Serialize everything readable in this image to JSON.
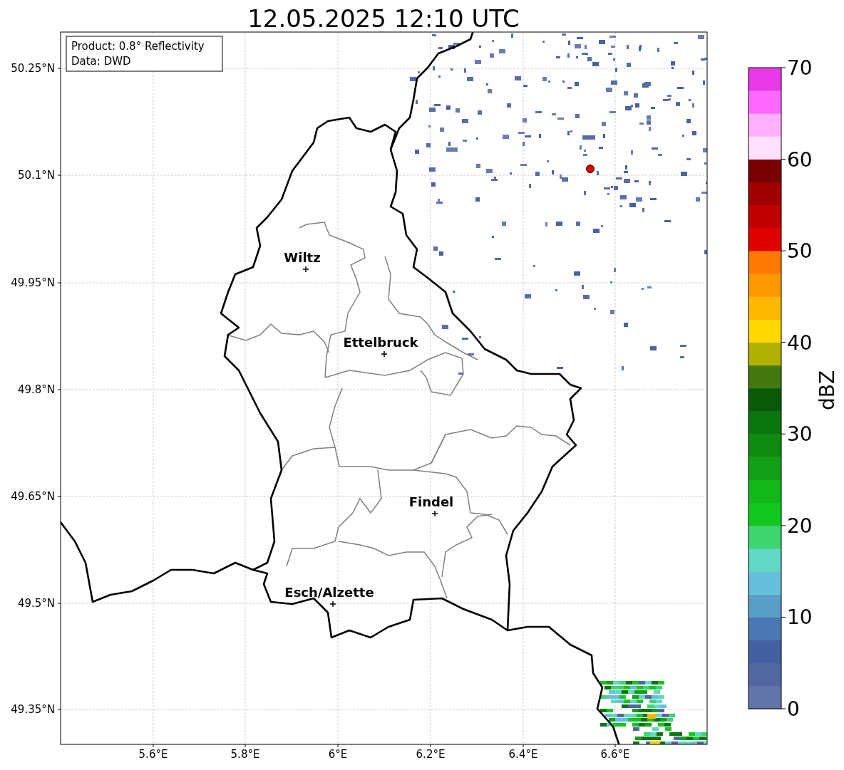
{
  "title": "12.05.2025 12:10 UTC",
  "info_box": [
    "Product: 0.8° Reflectivity",
    "Data: DWD"
  ],
  "lat_ticks": [
    "50.25°N",
    "50.1°N",
    "49.95°N",
    "49.8°N",
    "49.65°N",
    "49.5°N",
    "49.35°N"
  ],
  "lon_ticks": [
    "5.6°E",
    "5.8°E",
    "6°E",
    "6.2°E",
    "6.4°E",
    "6.6°E"
  ],
  "cities": [
    {
      "name": "Wiltz"
    },
    {
      "name": "Ettelbruck"
    },
    {
      "name": "Findel"
    },
    {
      "name": "Esch/Alzette"
    }
  ],
  "colorbar": {
    "label": "dBZ",
    "ticks": [
      "70",
      "60",
      "50",
      "40",
      "30",
      "20",
      "10",
      "0"
    ],
    "bands": [
      {
        "color": "#6374a8"
      },
      {
        "color": "#5266a0"
      },
      {
        "color": "#4460a2"
      },
      {
        "color": "#4a78b2"
      },
      {
        "color": "#5a9ec8"
      },
      {
        "color": "#66c0dc"
      },
      {
        "color": "#60d8c4"
      },
      {
        "color": "#3ed470"
      },
      {
        "color": "#12c820"
      },
      {
        "color": "#12b81a"
      },
      {
        "color": "#12a018"
      },
      {
        "color": "#0e8a10"
      },
      {
        "color": "#0a740e"
      },
      {
        "color": "#085a08"
      },
      {
        "color": "#447810"
      },
      {
        "color": "#b0b000"
      },
      {
        "color": "#ffd800"
      },
      {
        "color": "#ffb800"
      },
      {
        "color": "#ff9800"
      },
      {
        "color": "#ff7800"
      },
      {
        "color": "#e00000"
      },
      {
        "color": "#c00000"
      },
      {
        "color": "#a00000"
      },
      {
        "color": "#780000"
      },
      {
        "color": "#ffe0ff"
      },
      {
        "color": "#ffb0ff"
      },
      {
        "color": "#ff68ff"
      },
      {
        "color": "#e838e8"
      }
    ]
  }
}
